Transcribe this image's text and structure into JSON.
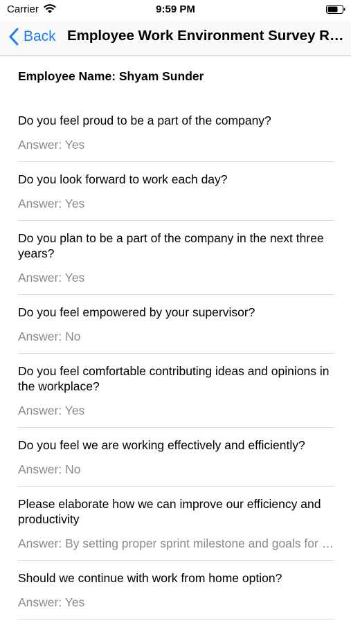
{
  "status_bar": {
    "carrier": "Carrier",
    "time": "9:59 PM"
  },
  "nav": {
    "back_label": "Back",
    "title": "Employee Work Environment Survey Result"
  },
  "employee": {
    "name_line": "Employee Name: Shyam Sunder"
  },
  "survey": {
    "items": [
      {
        "question": "Do you feel proud to be a part of the company?",
        "answer": "Answer: Yes"
      },
      {
        "question": "Do you look forward to work each day?",
        "answer": "Answer: Yes"
      },
      {
        "question": "Do you plan to be a part of the company in the next three years?",
        "answer": "Answer: Yes"
      },
      {
        "question": "Do you feel empowered by your supervisor?",
        "answer": "Answer: No"
      },
      {
        "question": "Do you feel comfortable contributing ideas and opinions in the workplace?",
        "answer": "Answer: Yes"
      },
      {
        "question": "Do you feel we are working effectively and efficiently?",
        "answer": "Answer: No"
      },
      {
        "question": "Please elaborate how we can improve our efficiency and productivity",
        "answer": "Answer: By setting proper sprint milestone and goals for each team"
      },
      {
        "question": "Should we continue with work from home option?",
        "answer": "Answer: Yes"
      }
    ]
  }
}
